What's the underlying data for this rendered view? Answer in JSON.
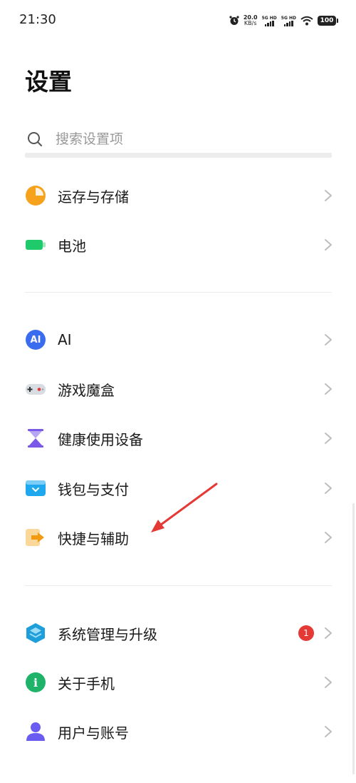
{
  "status": {
    "time": "21:30",
    "speed_value": "20.0",
    "speed_unit": "KB/s",
    "sim1": "5G HD",
    "sim2": "5G HD",
    "battery": "100"
  },
  "page": {
    "title": "设置"
  },
  "search": {
    "placeholder": "搜索设置项"
  },
  "groups": {
    "storage": {
      "label": "运存与存储",
      "icon": "pie-chart-icon",
      "color": "#f7a21c"
    },
    "battery": {
      "label": "电池",
      "icon": "battery-icon",
      "color": "#1fca6a"
    },
    "ai": {
      "label": "AI",
      "icon": "ai-icon",
      "icon_text": "AI",
      "color": "#3a6cf0"
    },
    "game": {
      "label": "游戏魔盒",
      "icon": "gamepad-icon",
      "color": "#d8dde3"
    },
    "health": {
      "label": "健康使用设备",
      "icon": "hourglass-icon",
      "color": "#7a58e8"
    },
    "wallet": {
      "label": "钱包与支付",
      "icon": "wallet-icon",
      "color": "#20a8ef"
    },
    "shortcut": {
      "label": "快捷与辅助",
      "icon": "shortcut-icon",
      "color": "#f6a91c"
    },
    "system": {
      "label": "系统管理与升级",
      "icon": "layers-icon",
      "color": "#1e9fd9",
      "badge": "1"
    },
    "about": {
      "label": "关于手机",
      "icon": "info-icon",
      "icon_text": "i",
      "color": "#1fb36a"
    },
    "users": {
      "label": "用户与账号",
      "icon": "user-icon",
      "color": "#6a5cf0"
    }
  }
}
